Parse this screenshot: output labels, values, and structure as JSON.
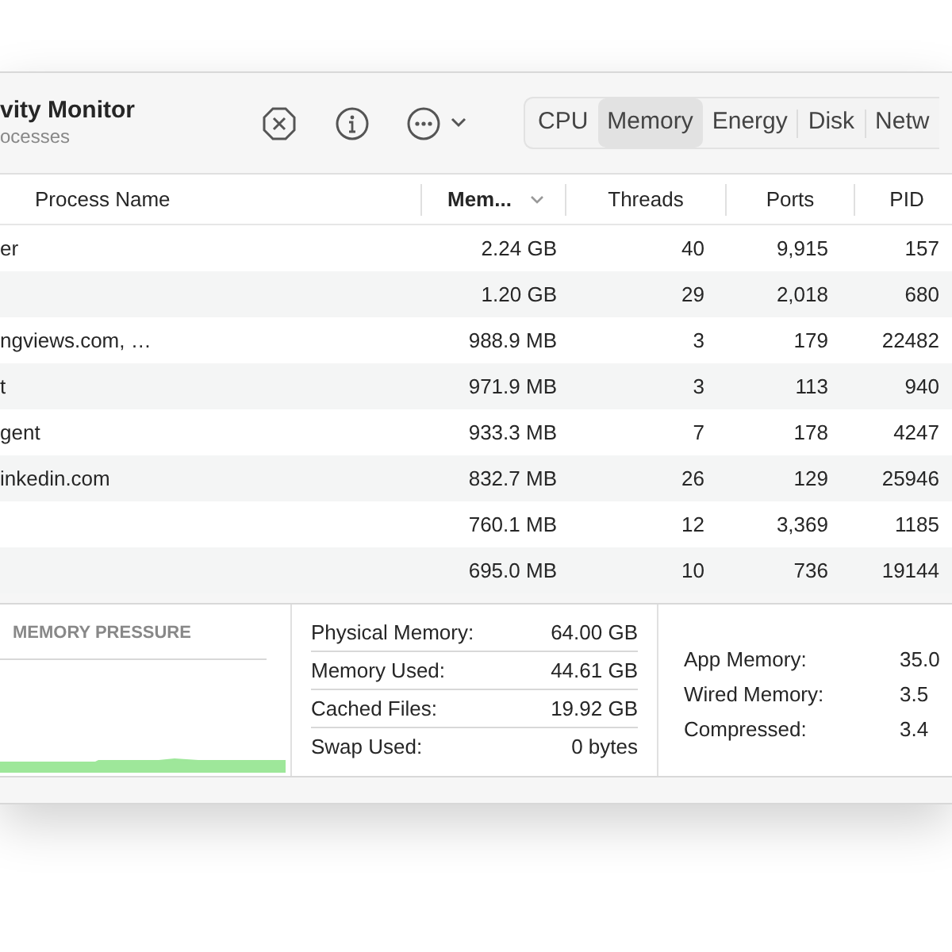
{
  "window": {
    "title": "vity Monitor",
    "subtitle": "ocesses"
  },
  "toolbar": {
    "tabs": [
      {
        "label": "CPU",
        "selected": false
      },
      {
        "label": "Memory",
        "selected": true
      },
      {
        "label": "Energy",
        "selected": false
      },
      {
        "label": "Disk",
        "selected": false
      },
      {
        "label": "Netw",
        "selected": false
      }
    ]
  },
  "table": {
    "columns": [
      {
        "label": "Process Name",
        "sorted": false
      },
      {
        "label": "Mem...",
        "sorted": true
      },
      {
        "label": "Threads",
        "sorted": false
      },
      {
        "label": "Ports",
        "sorted": false
      },
      {
        "label": "PID",
        "sorted": false
      }
    ],
    "rows": [
      {
        "name": "er",
        "memory": "2.24 GB",
        "threads": "40",
        "ports": "9,915",
        "pid": "157"
      },
      {
        "name": "",
        "memory": "1.20 GB",
        "threads": "29",
        "ports": "2,018",
        "pid": "680"
      },
      {
        "name": "ngviews.com, …",
        "memory": "988.9 MB",
        "threads": "3",
        "ports": "179",
        "pid": "22482"
      },
      {
        "name": "t",
        "memory": "971.9 MB",
        "threads": "3",
        "ports": "113",
        "pid": "940"
      },
      {
        "name": "gent",
        "memory": "933.3 MB",
        "threads": "7",
        "ports": "178",
        "pid": "4247"
      },
      {
        "name": "inkedin.com",
        "memory": "832.7 MB",
        "threads": "26",
        "ports": "129",
        "pid": "25946"
      },
      {
        "name": "",
        "memory": "760.1 MB",
        "threads": "12",
        "ports": "3,369",
        "pid": "1185"
      },
      {
        "name": "",
        "memory": "695.0 MB",
        "threads": "10",
        "ports": "736",
        "pid": "19144"
      }
    ]
  },
  "memory_pressure": {
    "title": "MEMORY PRESSURE"
  },
  "stats": [
    {
      "label": "Physical Memory:",
      "value": "64.00 GB"
    },
    {
      "label": "Memory Used:",
      "value": "44.61 GB"
    },
    {
      "label": "Cached Files:",
      "value": "19.92 GB"
    },
    {
      "label": "Swap Used:",
      "value": "0 bytes"
    }
  ],
  "breakdown": [
    {
      "label": "App Memory:",
      "value": "35.0"
    },
    {
      "label": "Wired Memory:",
      "value": "3.5"
    },
    {
      "label": "Compressed:",
      "value": "3.4"
    }
  ]
}
